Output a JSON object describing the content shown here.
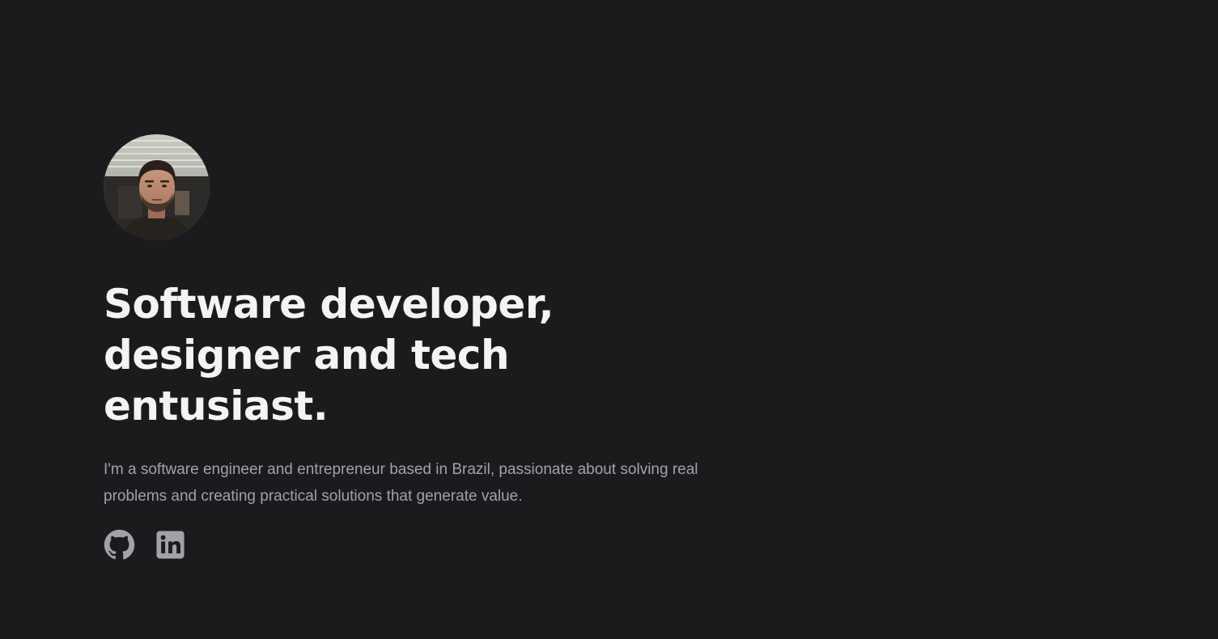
{
  "profile": {
    "avatar_alt": "profile photo"
  },
  "hero": {
    "headline": "Software developer, designer and tech entusiast.",
    "bio": "I'm a software engineer and entrepreneur based in Brazil, passionate about solving real problems and creating practical solutions that generate value."
  },
  "social": [
    {
      "icon": "github-icon"
    },
    {
      "icon": "linkedin-icon"
    }
  ],
  "colors": {
    "background": "#1b1b1e",
    "headline": "#f4f4f5",
    "body_text": "#a1a1aa",
    "icon": "#a1a1aa"
  }
}
